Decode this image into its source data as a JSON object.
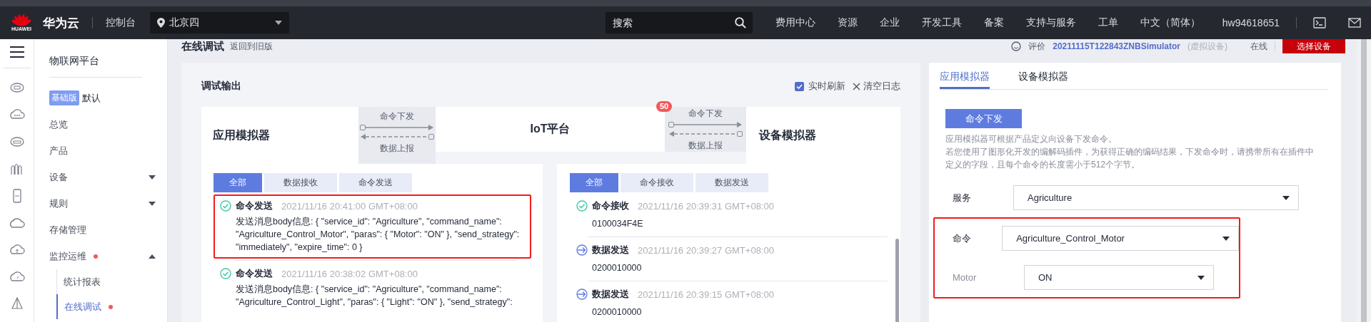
{
  "top_nav": {
    "logo_text": "HUAWEI",
    "brand": "华为云",
    "console": "控制台",
    "region": "北京四",
    "search_placeholder": "搜索",
    "links": [
      "费用中心",
      "资源",
      "企业",
      "开发工具",
      "备案",
      "支持与服务",
      "工单",
      "中文（简体）"
    ],
    "user": "hw94618651"
  },
  "sidebar": {
    "title": "物联网平台",
    "edition_badge": "基础版",
    "edition": "默认",
    "items": [
      {
        "label": "总览",
        "selected": false,
        "alert": false
      },
      {
        "label": "产品",
        "selected": false,
        "alert": false
      },
      {
        "label": "设备",
        "selected": false,
        "alert": false,
        "expanded": false
      },
      {
        "label": "规则",
        "selected": false,
        "alert": false,
        "expanded": false
      },
      {
        "label": "存储管理",
        "selected": false,
        "alert": false
      },
      {
        "label": "监控运维",
        "selected": false,
        "alert": true,
        "expanded": true,
        "children": [
          {
            "label": "统计报表",
            "selected": false,
            "alert": false
          },
          {
            "label": "在线调试",
            "selected": true,
            "alert": true
          }
        ]
      }
    ]
  },
  "page_header": {
    "title": "在线调试",
    "back_link": "返回到旧版",
    "rate": "评价",
    "device_name": "20211115T122843ZNBSimulator",
    "device_note": "(虚拟设备)",
    "status": "在线",
    "select_button": "选择设备"
  },
  "debug_output": {
    "title": "调试输出",
    "realtime_refresh": {
      "label": "实时刷新",
      "checked": true
    },
    "clear_log": "清空日志",
    "diagram": {
      "app_simulator": "应用模拟器",
      "platform": "IoT平台",
      "platform_badge": "50",
      "device_simulator": "设备模拟器",
      "links": [
        {
          "down": "命令下发",
          "up": "数据上报"
        },
        {
          "down": "命令下发",
          "up": "数据上报"
        }
      ]
    },
    "app_log": {
      "tabs": [
        {
          "label": "全部",
          "selected": true
        },
        {
          "label": "数据接收",
          "selected": false
        },
        {
          "label": "命令发送",
          "selected": false
        }
      ],
      "entries": [
        {
          "kind": "success",
          "title": "命令发送",
          "time": "2021/11/16 20:41:00 GMT+08:00",
          "body": "发送消息body信息: { \"service_id\": \"Agriculture\", \"command_name\": \"Agriculture_Control_Motor\", \"paras\": { \"Motor\": \"ON\" }, \"send_strategy\": \"immediately\", \"expire_time\": 0 }",
          "highlighted": true
        },
        {
          "kind": "success",
          "title": "命令发送",
          "time": "2021/11/16 20:38:02 GMT+08:00",
          "body": "发送消息body信息: { \"service_id\": \"Agriculture\", \"command_name\": \"Agriculture_Control_Light\", \"paras\": { \"Light\": \"ON\" }, \"send_strategy\":",
          "highlighted": false
        }
      ]
    },
    "device_log": {
      "tabs": [
        {
          "label": "全部",
          "selected": true
        },
        {
          "label": "命令接收",
          "selected": false
        },
        {
          "label": "数据发送",
          "selected": false
        }
      ],
      "entries": [
        {
          "kind": "success",
          "title": "命令接收",
          "time": "2021/11/16 20:39:31 GMT+08:00",
          "body": "0100034F4E",
          "highlighted": false
        },
        {
          "kind": "send",
          "title": "数据发送",
          "time": "2021/11/16 20:39:27 GMT+08:00",
          "body": "0200010000",
          "highlighted": false
        },
        {
          "kind": "send",
          "title": "数据发送",
          "time": "2021/11/16 20:39:15 GMT+08:00",
          "body": "0200010000",
          "highlighted": false
        }
      ]
    }
  },
  "simulator_panel": {
    "tabs": [
      {
        "label": "应用模拟器",
        "selected": true
      },
      {
        "label": "设备模拟器",
        "selected": false
      }
    ],
    "send_button": "命令下发",
    "description": [
      "应用模拟器可根据产品定义向设备下发命令。",
      "若您使用了图形化开发的编解码插件，为获得正确的编码结果，下发命令时，请携带所有在插件中定义的字段，且每个命令的长度需小于512个字节。"
    ],
    "fields": [
      {
        "kind": "select",
        "label": "服务",
        "value": "Agriculture"
      }
    ],
    "command_group": {
      "highlighted": true,
      "fields": [
        {
          "kind": "select",
          "label": "命令",
          "value": "Agriculture_Control_Motor"
        },
        {
          "kind": "parameter",
          "label": "Motor",
          "value": "ON"
        }
      ]
    }
  }
}
